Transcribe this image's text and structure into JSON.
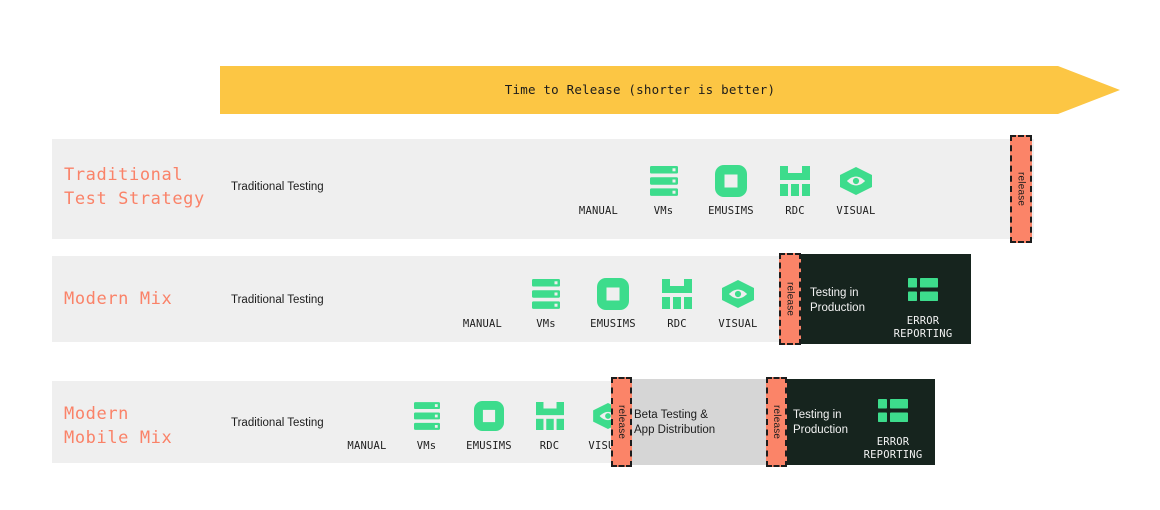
{
  "theme": {
    "accent_coral": "#fb8468",
    "accent_green": "#3ddc8c",
    "arrow_yellow": "#fcc644",
    "band_grey": "#efefef",
    "panel_grey": "#d6d6d6",
    "panel_dark": "#16241e"
  },
  "arrow": {
    "label": "Time to Release (shorter is better)"
  },
  "tools": {
    "manual": "MANUAL",
    "vms": "VMs",
    "emusims": "EMUSIMS",
    "rdc": "RDC",
    "visual": "VISUAL"
  },
  "labels": {
    "traditional_testing": "Traditional Testing",
    "release": "release",
    "testing_in_production": "Testing in\nProduction",
    "beta_testing": "Beta Testing &\nApp Distribution",
    "error_reporting": "ERROR\nREPORTING"
  },
  "rows": [
    {
      "title": "Traditional\nTest Strategy",
      "traditional_testing": "Traditional Testing",
      "tools": [
        "MANUAL",
        "VMs",
        "EMUSIMS",
        "RDC",
        "VISUAL"
      ],
      "releases": [
        "release"
      ],
      "panels": []
    },
    {
      "title": "Modern Mix",
      "traditional_testing": "Traditional Testing",
      "tools": [
        "MANUAL",
        "VMs",
        "EMUSIMS",
        "RDC",
        "VISUAL"
      ],
      "releases": [
        "release"
      ],
      "panels": [
        {
          "kind": "dark",
          "text": "Testing in\nProduction",
          "badge": "ERROR\nREPORTING"
        }
      ]
    },
    {
      "title": "Modern\nMobile Mix",
      "traditional_testing": "Traditional Testing",
      "tools": [
        "MANUAL",
        "VMs",
        "EMUSIMS",
        "RDC",
        "VISUAL"
      ],
      "releases": [
        "release",
        "release"
      ],
      "panels": [
        {
          "kind": "grey",
          "text": "Beta Testing &\nApp Distribution",
          "badge": null
        },
        {
          "kind": "dark",
          "text": "Testing in\nProduction",
          "badge": "ERROR\nREPORTING"
        }
      ]
    }
  ]
}
